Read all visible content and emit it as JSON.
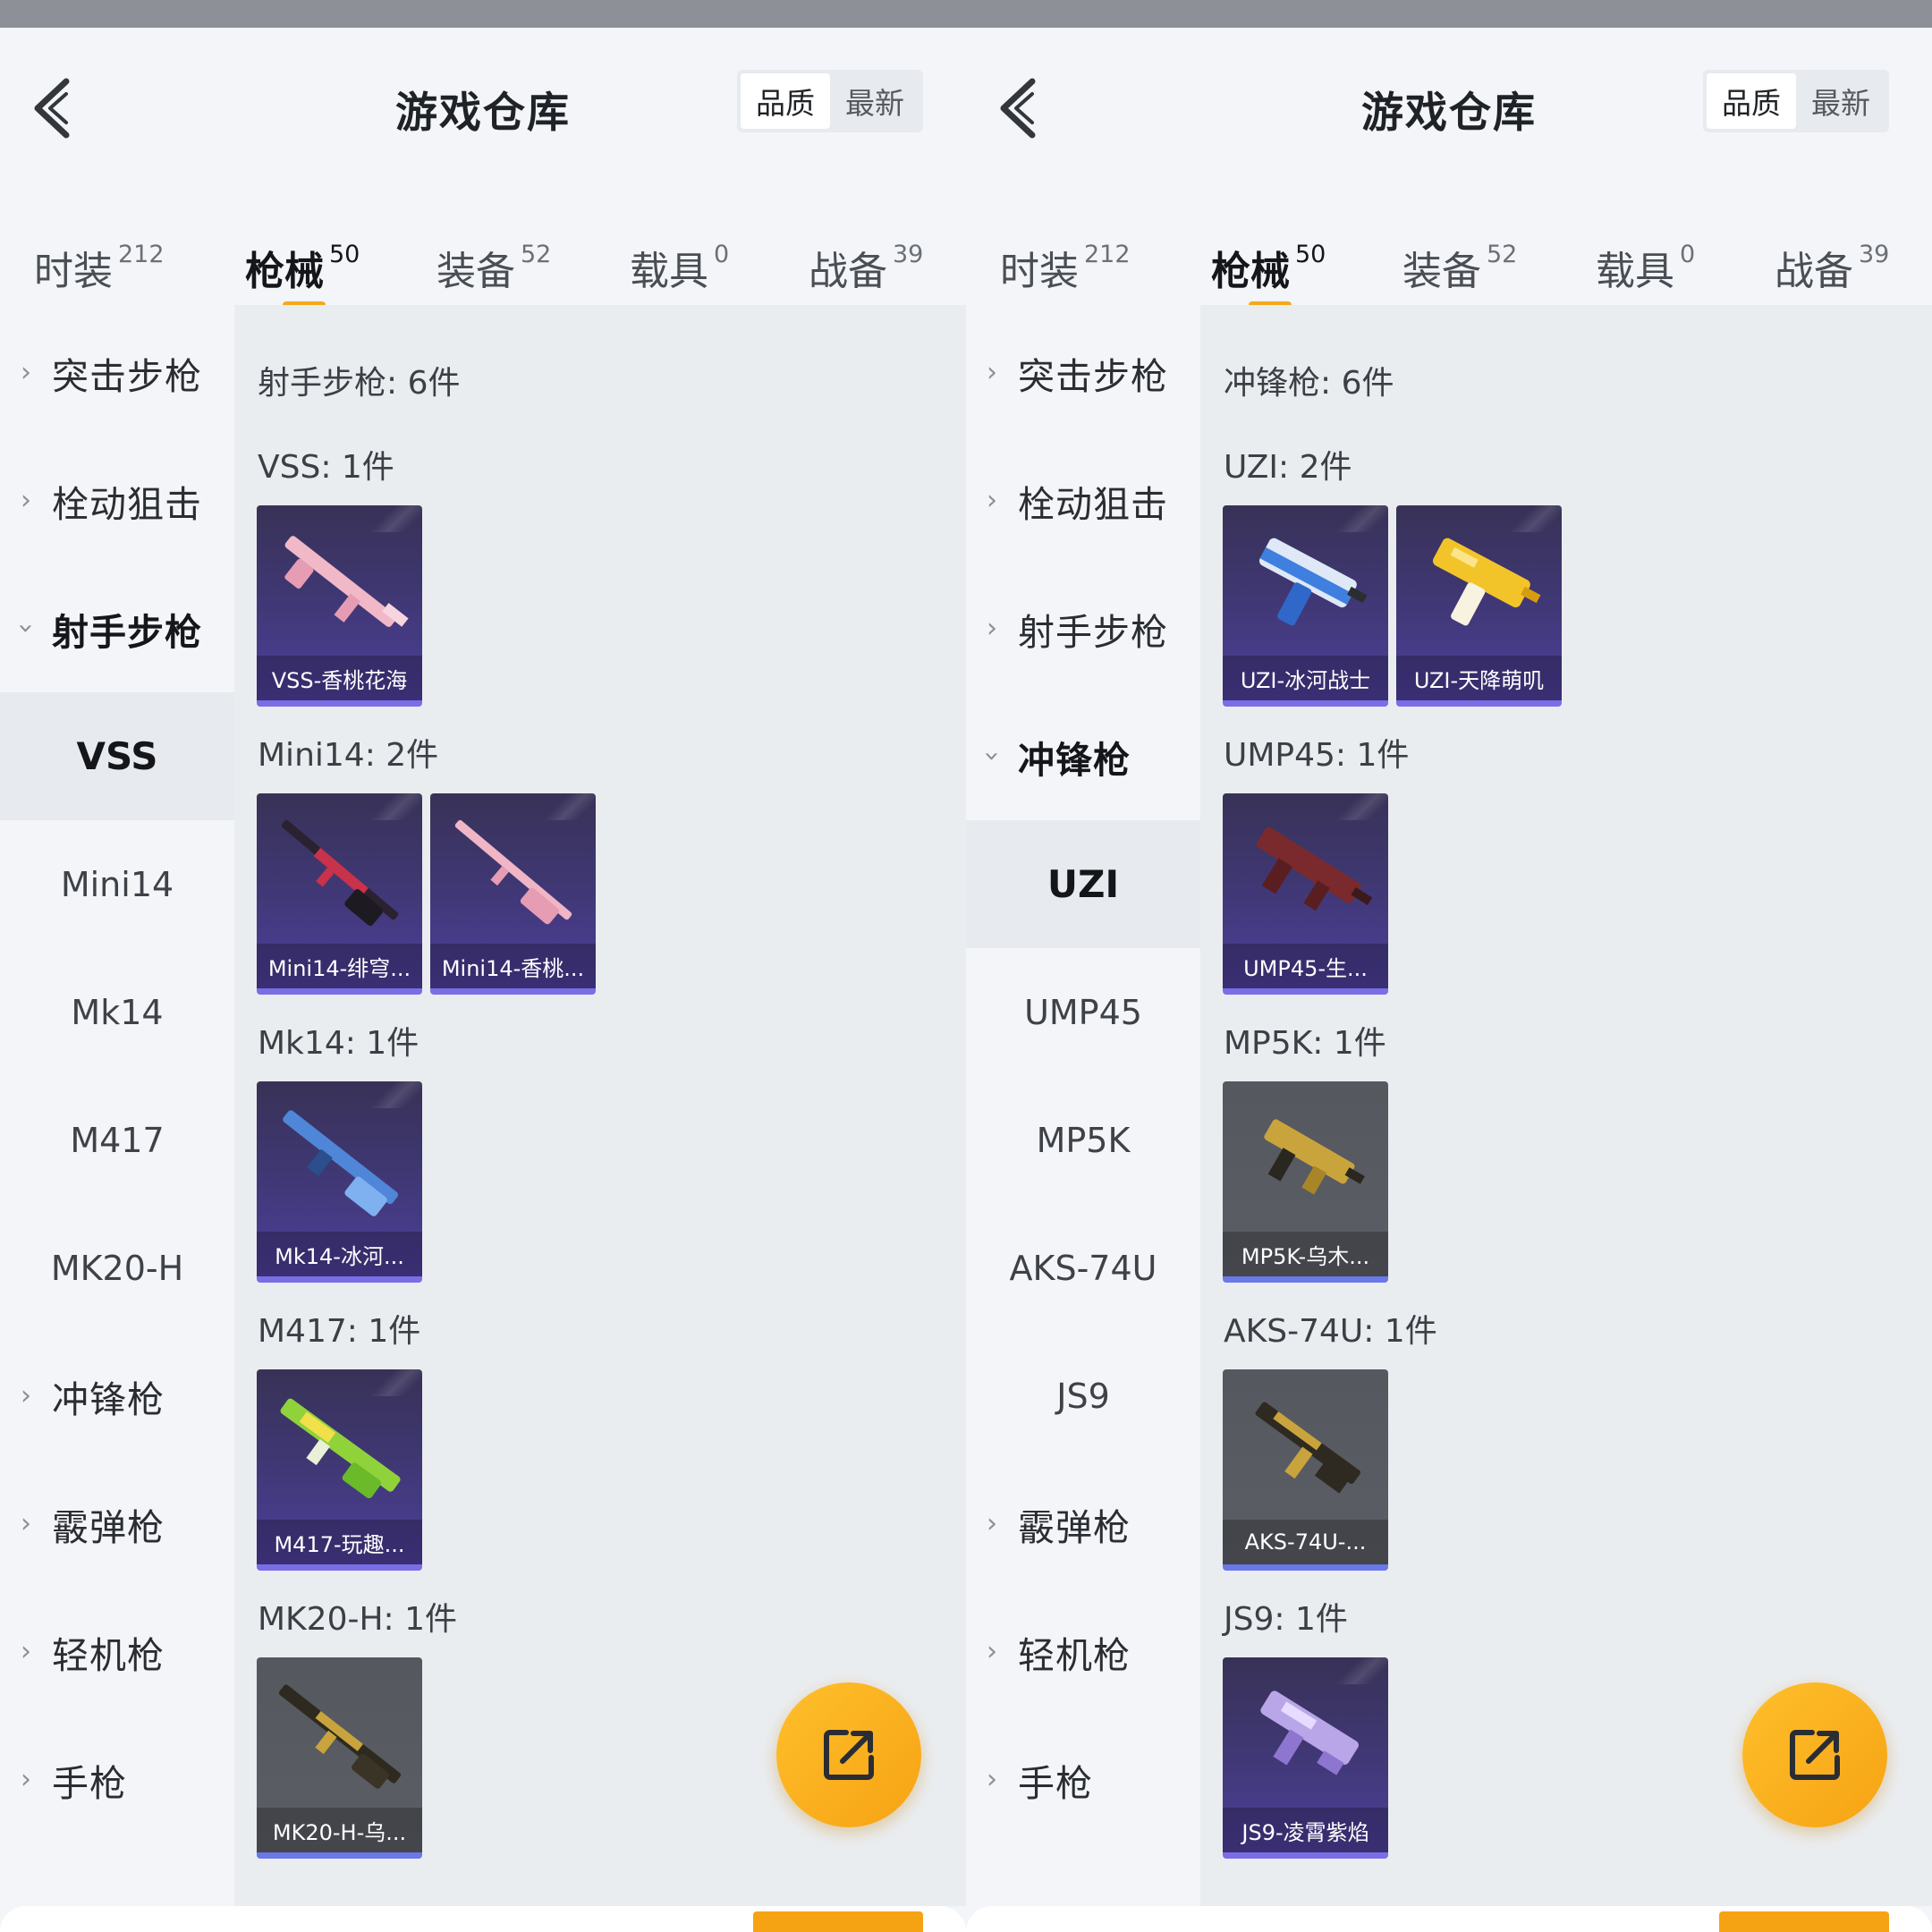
{
  "left": {
    "title": "游戏仓库",
    "sort": [
      "品质",
      "最新"
    ],
    "tabs": [
      {
        "label": "时装",
        "count": "212"
      },
      {
        "label": "枪械",
        "count": "50"
      },
      {
        "label": "装备",
        "count": "52"
      },
      {
        "label": "载具",
        "count": "0"
      },
      {
        "label": "战备",
        "count": "39"
      }
    ],
    "categories": [
      "突击步枪",
      "栓动狙击",
      "射手步枪",
      "冲锋枪",
      "霰弹枪",
      "轻机枪",
      "手枪"
    ],
    "subs": [
      "VSS",
      "Mini14",
      "Mk14",
      "M417",
      "MK20-H"
    ],
    "header": "射手步枪: 6件",
    "sections": [
      {
        "title": "VSS: 1件",
        "items": [
          "VSS-香桃花海"
        ]
      },
      {
        "title": "Mini14: 2件",
        "items": [
          "Mini14-绯穹...",
          "Mini14-香桃..."
        ]
      },
      {
        "title": "Mk14: 1件",
        "items": [
          "Mk14-冰河..."
        ]
      },
      {
        "title": "M417: 1件",
        "items": [
          "M417-玩趣..."
        ]
      },
      {
        "title": "MK20-H: 1件",
        "items": [
          "MK20-H-乌..."
        ]
      }
    ]
  },
  "right": {
    "title": "游戏仓库",
    "sort": [
      "品质",
      "最新"
    ],
    "tabs": [
      {
        "label": "时装",
        "count": "212"
      },
      {
        "label": "枪械",
        "count": "50"
      },
      {
        "label": "装备",
        "count": "52"
      },
      {
        "label": "载具",
        "count": "0"
      },
      {
        "label": "战备",
        "count": "39"
      }
    ],
    "categories": [
      "突击步枪",
      "栓动狙击",
      "射手步枪",
      "冲锋枪",
      "霰弹枪",
      "轻机枪",
      "手枪"
    ],
    "subs": [
      "UZI",
      "UMP45",
      "MP5K",
      "AKS-74U",
      "JS9"
    ],
    "header": "冲锋枪: 6件",
    "sections": [
      {
        "title": "UZI: 2件",
        "items": [
          "UZI-冰河战士",
          "UZI-天降萌叽"
        ]
      },
      {
        "title": "UMP45: 1件",
        "items": [
          "UMP45-生..."
        ]
      },
      {
        "title": "MP5K: 1件",
        "items": [
          "MP5K-乌木..."
        ]
      },
      {
        "title": "AKS-74U: 1件",
        "items": [
          "AKS-74U-..."
        ]
      },
      {
        "title": "JS9: 1件",
        "items": [
          "JS9-凌霄紫焰"
        ]
      }
    ]
  },
  "colors": {
    "accent": "#f4a81c",
    "purple_card": "#4d3f9a",
    "gray_card": "#5b5e65"
  },
  "icons": [
    "back-arrow-icon",
    "chevron-right-icon",
    "chevron-down-icon",
    "share-icon"
  ]
}
